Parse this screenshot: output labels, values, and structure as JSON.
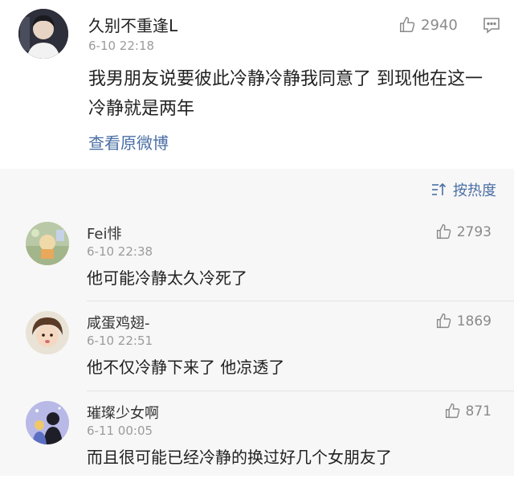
{
  "main_post": {
    "author": "久别不重逢L",
    "time": "6-10 22:18",
    "likes": "2940",
    "text": "我男朋友说要彼此冷静冷静我同意了 到现他在这一冷静就是两年",
    "view_original": "查看原微博"
  },
  "sort": {
    "label": "按热度"
  },
  "comments": [
    {
      "author": "Fei悱",
      "time": "6-10 22:38",
      "likes": "2793",
      "text": "他可能冷静太久冷死了"
    },
    {
      "author": "咸蛋鸡翅-",
      "time": "6-10 22:51",
      "likes": "1869",
      "text": "他不仅冷静下来了 他凉透了"
    },
    {
      "author": "璀璨少女啊",
      "time": "6-11 00:05",
      "likes": "871",
      "text": "而且很可能已经冷静的换过好几个女朋友了"
    }
  ],
  "colors": {
    "link": "#4a6fa5",
    "meta": "#9b9b9b",
    "comments_bg": "#f7f7f7"
  }
}
